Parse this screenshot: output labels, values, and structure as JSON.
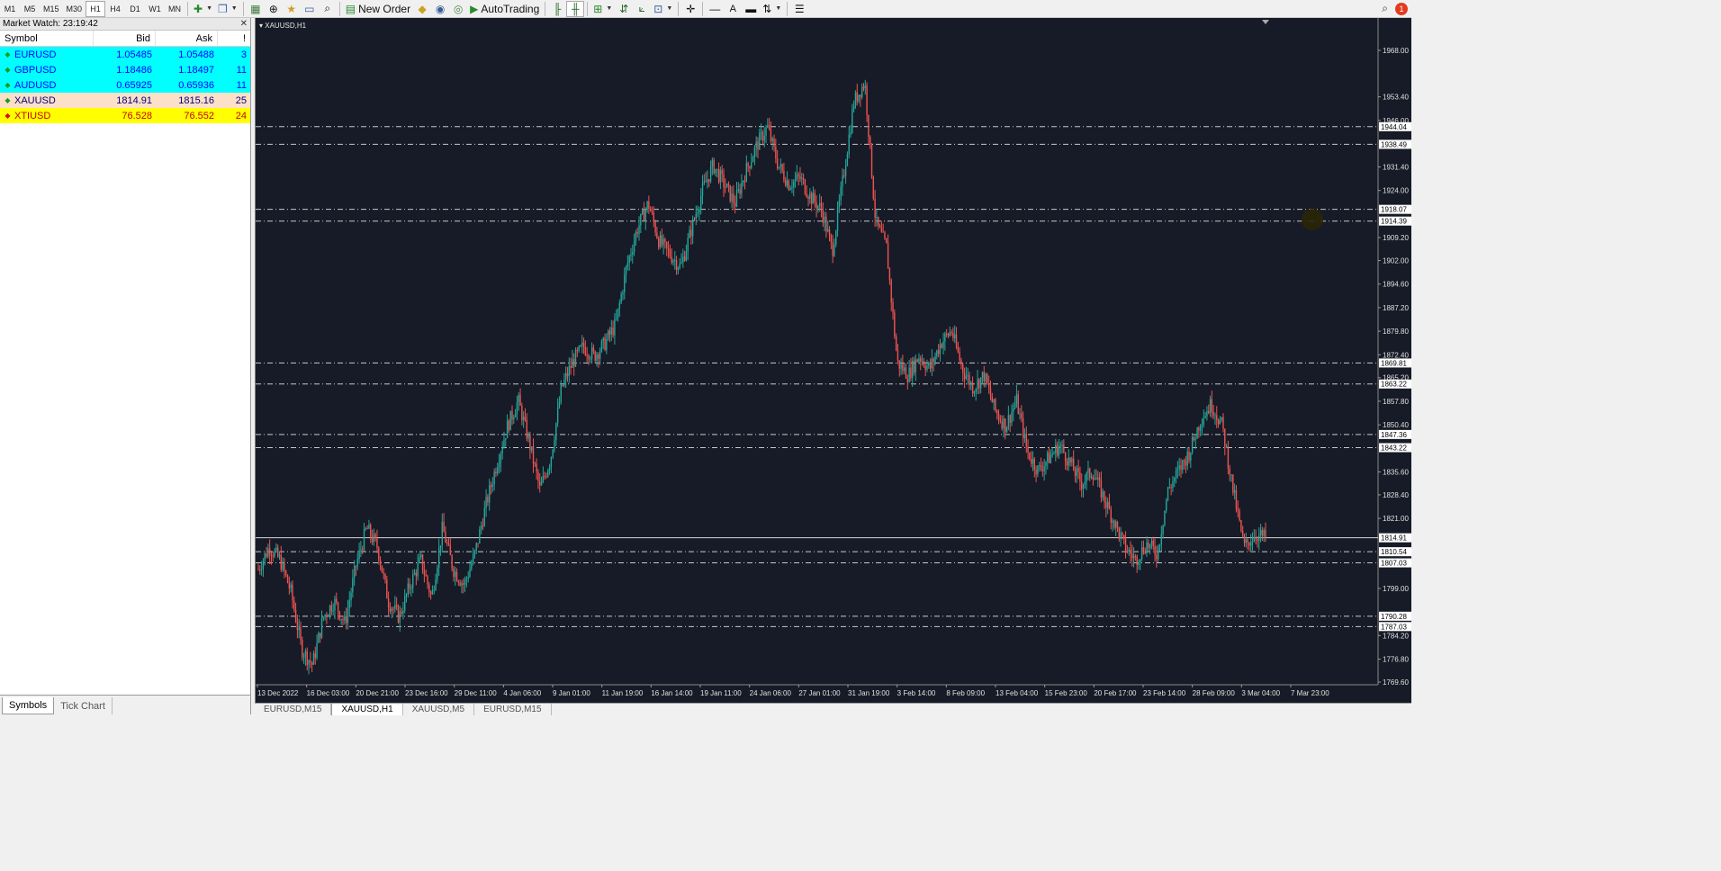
{
  "toolbar": {
    "timeframes": [
      "M1",
      "M5",
      "M15",
      "M30",
      "H1",
      "H4",
      "D1",
      "W1",
      "MN"
    ],
    "active_timeframe": "H1",
    "new_order_label": "New Order",
    "autotrading_label": "AutoTrading",
    "notification_count": "1"
  },
  "market_watch": {
    "title": "Market Watch: 23:19:42",
    "columns": {
      "symbol": "Symbol",
      "bid": "Bid",
      "ask": "Ask",
      "spread": "!"
    },
    "rows": [
      {
        "symbol": "EURUSD",
        "bid": "1.05485",
        "ask": "1.05488",
        "spread": "3",
        "bg": "#00ffff",
        "fg": "#0000ff",
        "arrow_color": "#1a9a1a"
      },
      {
        "symbol": "GBPUSD",
        "bid": "1.18486",
        "ask": "1.18497",
        "spread": "11",
        "bg": "#00ffff",
        "fg": "#0000ff",
        "arrow_color": "#1a9a1a"
      },
      {
        "symbol": "AUDUSD",
        "bid": "0.65925",
        "ask": "0.65936",
        "spread": "11",
        "bg": "#00ffff",
        "fg": "#0000ff",
        "arrow_color": "#1a9a1a"
      },
      {
        "symbol": "XAUUSD",
        "bid": "1814.91",
        "ask": "1815.16",
        "spread": "25",
        "bg": "#fde0c8",
        "fg": "#000080",
        "arrow_color": "#1a9a1a"
      },
      {
        "symbol": "XTIUSD",
        "bid": "76.528",
        "ask": "76.552",
        "spread": "24",
        "bg": "#ffff00",
        "fg": "#c80000",
        "arrow_color": "#d01010"
      }
    ],
    "tabs": [
      "Symbols",
      "Tick Chart"
    ],
    "active_tab": "Symbols"
  },
  "chart": {
    "title": "XAUUSD,H1",
    "colors": {
      "background": "#161b27",
      "bull": "#26a69a",
      "bear": "#ef5350",
      "axis_text": "#e0e0e0"
    },
    "price_labels": [
      "1968.00",
      "1953.40",
      "1946.00",
      "1931.40",
      "1924.00",
      "1909.20",
      "1902.00",
      "1894.60",
      "1887.20",
      "1879.80",
      "1872.40",
      "1865.20",
      "1857.80",
      "1850.40",
      "1835.60",
      "1828.40",
      "1821.00",
      "1799.00",
      "1784.20",
      "1776.80",
      "1769.60"
    ],
    "level_labels": [
      "1944.04",
      "1938.49",
      "1918.07",
      "1914.39",
      "1869.81",
      "1863.22",
      "1847.36",
      "1843.22",
      "1814.91",
      "1810.54",
      "1807.03",
      "1790.28",
      "1787.03"
    ],
    "current_price": "1814.91",
    "time_labels": [
      "13 Dec 2022",
      "16 Dec 03:00",
      "20 Dec 21:00",
      "23 Dec 16:00",
      "29 Dec 11:00",
      "4 Jan 06:00",
      "9 Jan 01:00",
      "11 Jan 19:00",
      "16 Jan 14:00",
      "19 Jan 11:00",
      "24 Jan 06:00",
      "27 Jan 01:00",
      "31 Jan 19:00",
      "3 Feb 14:00",
      "8 Feb 09:00",
      "13 Feb 04:00",
      "15 Feb 23:00",
      "20 Feb 17:00",
      "23 Feb 14:00",
      "28 Feb 09:00",
      "3 Mar 04:00",
      "7 Mar 23:00"
    ],
    "y_range": [
      1769.6,
      1968.0
    ],
    "price_path": [
      1805,
      1812,
      1808,
      1798,
      1780,
      1775,
      1790,
      1795,
      1788,
      1806,
      1818,
      1812,
      1795,
      1790,
      1800,
      1808,
      1796,
      1818,
      1805,
      1800,
      1810,
      1825,
      1838,
      1850,
      1858,
      1845,
      1830,
      1840,
      1862,
      1870,
      1875,
      1872,
      1876,
      1882,
      1900,
      1912,
      1920,
      1908,
      1904,
      1900,
      1912,
      1924,
      1932,
      1926,
      1920,
      1930,
      1938,
      1944,
      1932,
      1926,
      1928,
      1922,
      1918,
      1905,
      1928,
      1952,
      1958,
      1914,
      1906,
      1870,
      1866,
      1872,
      1868,
      1876,
      1880,
      1868,
      1862,
      1866,
      1855,
      1850,
      1858,
      1842,
      1836,
      1840,
      1844,
      1838,
      1832,
      1836,
      1828,
      1820,
      1812,
      1808,
      1813,
      1810,
      1830,
      1836,
      1842,
      1852,
      1857,
      1850,
      1830,
      1812,
      1816,
      1815
    ]
  }
}
